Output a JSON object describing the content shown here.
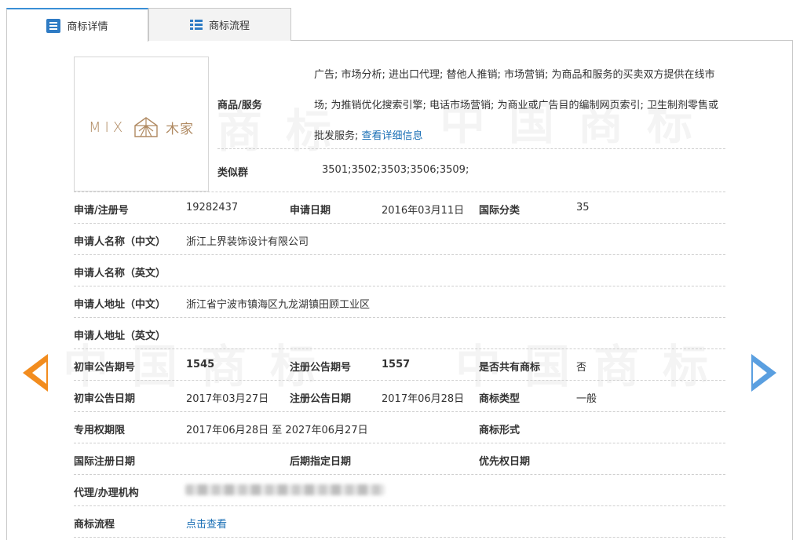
{
  "tabs": [
    {
      "label": "商标详情",
      "active": true
    },
    {
      "label": "商标流程",
      "active": false
    }
  ],
  "watermark": "中国商标",
  "logo": {
    "mark_text": "MIX",
    "cn_text": "木家",
    "color": "#b08a62"
  },
  "goods": {
    "label": "商品/服务",
    "text": "广告; 市场分析; 进出口代理; 替他人推销; 市场营销; 为商品和服务的买卖双方提供在线市场; 为推销优化搜索引擎; 电话市场营销; 为商业或广告目的编制网页索引; 卫生制剂零售或批发服务;",
    "link_text": "查看详细信息"
  },
  "similar_group": {
    "label": "类似群",
    "value": "3501;3502;3503;3506;3509;"
  },
  "fields": {
    "reg_no_label": "申请/注册号",
    "reg_no": "19282437",
    "apply_date_label": "申请日期",
    "apply_date": "2016年03月11日",
    "intl_class_label": "国际分类",
    "intl_class": "35",
    "applicant_cn_label": "申请人名称（中文）",
    "applicant_cn": "浙江上界装饰设计有限公司",
    "applicant_en_label": "申请人名称（英文）",
    "applicant_en": "",
    "address_cn_label": "申请人地址（中文）",
    "address_cn": "浙江省宁波市镇海区九龙湖镇田顾工业区",
    "address_en_label": "申请人地址（英文）",
    "address_en": "",
    "prelim_no_label": "初审公告期号",
    "prelim_no": "1545",
    "reg_announce_no_label": "注册公告期号",
    "reg_announce_no": "1557",
    "shared_label": "是否共有商标",
    "shared": "否",
    "prelim_date_label": "初审公告日期",
    "prelim_date": "2017年03月27日",
    "reg_announce_date_label": "注册公告日期",
    "reg_announce_date": "2017年06月28日",
    "type_label": "商标类型",
    "type": "一般",
    "exclusive_label": "专用权期限",
    "exclusive": "2017年06月28日 至 2027年06月27日",
    "form_label": "商标形式",
    "form": "",
    "intl_reg_date_label": "国际注册日期",
    "intl_reg_date": "",
    "later_designation_label": "后期指定日期",
    "later_designation": "",
    "priority_label": "优先权日期",
    "priority": "",
    "agent_label": "代理/办理机构",
    "process_label": "商标流程",
    "process_link": "点击查看"
  },
  "colors": {
    "tab_accent": "#3a8fd6",
    "link": "#1a6fb5",
    "prev_arrow": "#f28c1e",
    "next_arrow": "#5a9fe0"
  }
}
